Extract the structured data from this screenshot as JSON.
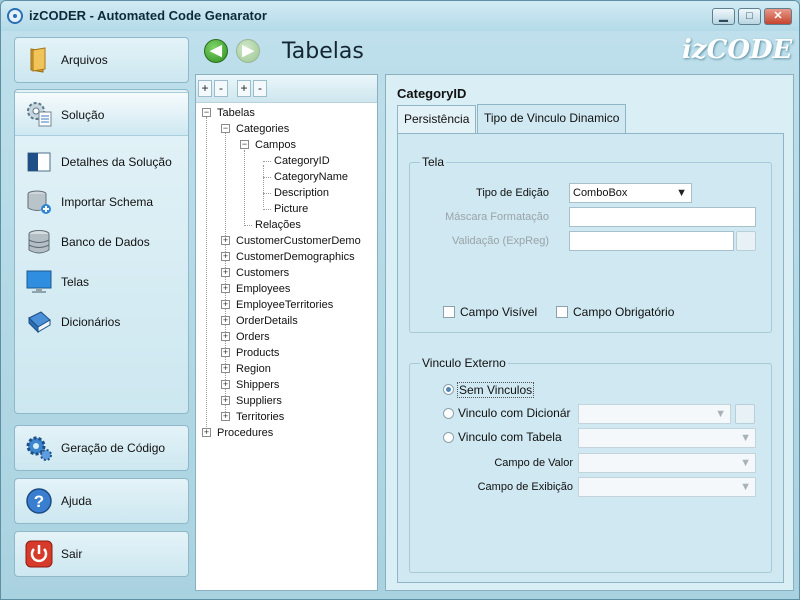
{
  "window": {
    "title": "izCODER - Automated Code Genarator",
    "min_glyph": "▁",
    "max_glyph": "□",
    "close_glyph": "✕"
  },
  "nav": {
    "top": {
      "label": "Arquivos",
      "icon": "folder-icon"
    },
    "items": [
      {
        "label": "Solução",
        "icon": "gear-document-icon",
        "selected": true
      },
      {
        "label": "Detalhes da Solução",
        "icon": "window-icon"
      },
      {
        "label": "Importar Schema",
        "icon": "database-import-icon"
      },
      {
        "label": "Banco de Dados",
        "icon": "database-icon"
      },
      {
        "label": "Telas",
        "icon": "monitor-icon"
      },
      {
        "label": "Dicionários",
        "icon": "book-icon"
      }
    ],
    "bottom": [
      {
        "label": "Geração de Código",
        "icon": "gears-icon"
      },
      {
        "label": "Ajuda",
        "icon": "help-icon"
      },
      {
        "label": "Sair",
        "icon": "power-icon"
      }
    ]
  },
  "header": {
    "page_title": "Tabelas",
    "brand": "izCODE"
  },
  "tree": {
    "toolbar": [
      "+",
      "-",
      "+",
      "-"
    ],
    "root": "Tabelas",
    "categories": "Categories",
    "campos": "Campos",
    "fields": [
      "CategoryID",
      "CategoryName",
      "Description",
      "Picture"
    ],
    "relacoes": "Relações",
    "tables": [
      "CustomerCustomerDemo",
      "CustomerDemographics",
      "Customers",
      "Employees",
      "EmployeeTerritories",
      "OrderDetails",
      "Orders",
      "Products",
      "Region",
      "Shippers",
      "Suppliers",
      "Territories"
    ],
    "procedures": "Procedures"
  },
  "detail": {
    "title": "CategoryID",
    "tabs": [
      "Persistência",
      "Tipo de Vinculo Dinamico"
    ],
    "tela": {
      "title": "Tela",
      "tipo_edicao_label": "Tipo de Edição",
      "tipo_edicao_value": "ComboBox",
      "mascara_label": "Máscara Formatação",
      "validacao_label": "Validação (ExpReg)",
      "campo_visivel": "Campo Visível",
      "campo_obrigatorio": "Campo Obrigatório"
    },
    "vinculo": {
      "title": "Vinculo Externo",
      "sem_vinculos": "Sem Vinculos",
      "com_dicionario": "Vinculo com Dicionár",
      "com_tabela": "Vinculo com Tabela",
      "campo_valor": "Campo de Valor",
      "campo_exibicao": "Campo de Exibição"
    }
  }
}
